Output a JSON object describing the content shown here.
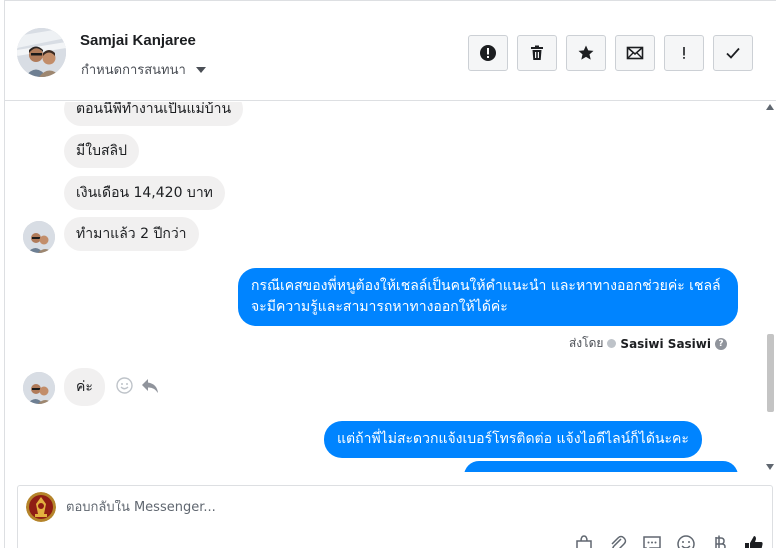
{
  "header": {
    "contact_name": "Samjai Kanjaree",
    "conversation_settings": "กำหนดการสนทนา",
    "actions": [
      {
        "name": "report-spam-button",
        "icon": "exclamation-circle-icon"
      },
      {
        "name": "delete-button",
        "icon": "trash-icon"
      },
      {
        "name": "star-button",
        "icon": "star-icon"
      },
      {
        "name": "mark-unread-button",
        "icon": "envelope-icon"
      },
      {
        "name": "follow-up-button",
        "icon": "exclamation-icon"
      },
      {
        "name": "mark-done-button",
        "icon": "checkmark-icon"
      }
    ]
  },
  "messages": {
    "incoming_1": "ตอนนี้พี่ทำงานเป็นแม่บ้าน",
    "incoming_2": "มีใบสลิป",
    "incoming_3": "เงินเดือน 14,420 บาท",
    "incoming_4": "ทำมาแล้ว 2 ปีกว่า",
    "outgoing_1": "กรณีเคสของพี่หนูต้องให้เชลล์เป็นคนให้คำแนะนำ และหาทางออกช่วยค่ะ เชลล์จะมีความรู้และสามารถหาทางออกให้ได้ค่ะ",
    "sent_by_label": "ส่งโดย",
    "sent_by_name": "Sasiwi Sasiwi",
    "incoming_5": "ค่ะ",
    "outgoing_2": "แต่ถ้าพี่ไม่สะดวกแจ้งเบอร์โทรติดต่อ แจ้งไอดีไลน์ก็ได้นะคะ"
  },
  "composer": {
    "placeholder": "ตอบกลับใน Messenger...",
    "tools": [
      "gift-bag-icon",
      "paperclip-icon",
      "saved-reply-icon",
      "emoji-icon",
      "baht-payment-icon",
      "thumbs-up-icon"
    ]
  },
  "colors": {
    "accent": "#0084ff",
    "incoming_bubble": "#f1f0f0"
  }
}
